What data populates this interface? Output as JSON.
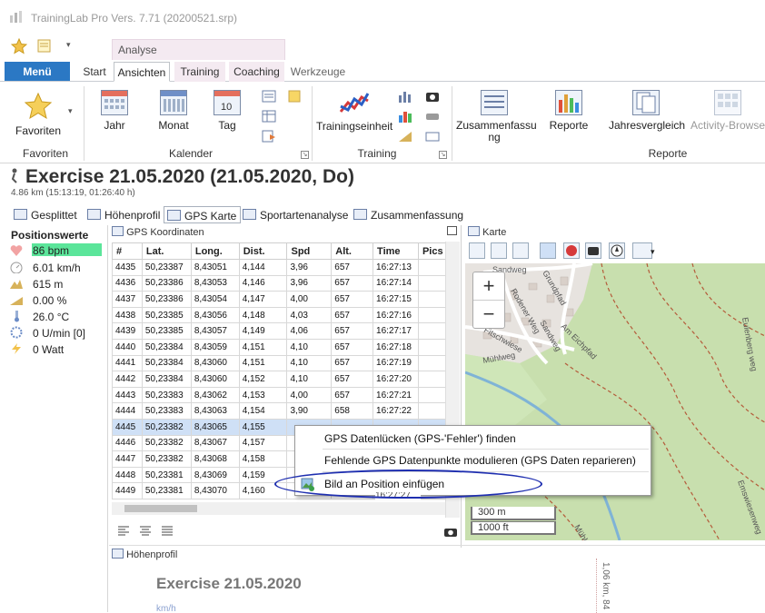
{
  "window": {
    "title": "TrainingLab Pro Vers. 7.71 (20200521.srp)"
  },
  "ribbon_tabs": {
    "menu": "Menü",
    "context_group": "Analyse",
    "items": [
      "Start",
      "Ansichten",
      "Training",
      "Coaching",
      "Werkzeuge"
    ],
    "active": "Ansichten"
  },
  "ribbon": {
    "favoriten": {
      "button": "Favoriten",
      "group": "Favoriten"
    },
    "kalender": {
      "jahr": "Jahr",
      "monat": "Monat",
      "tag": "Tag",
      "tag_icon_number": "10",
      "group": "Kalender"
    },
    "training": {
      "button": "Trainingseinheit",
      "group": "Training"
    },
    "reporte": {
      "zusammenfassung": "Zusammenfassu ng",
      "reporte": "Reporte",
      "jahresvergleich": "Jahresvergleich",
      "activity": "Activity-Browse",
      "group": "Reporte"
    }
  },
  "exercise": {
    "title": "Exercise 21.05.2020 (21.05.2020, Do)",
    "subtitle": "4.86 km (15:13:19, 01:26:40 h)"
  },
  "view_tabs": [
    "Gesplittet",
    "Höhenprofil",
    "GPS Karte",
    "Sportartenanalyse",
    "Zusammenfassung"
  ],
  "positionswerte": {
    "title": "Positionswerte",
    "rows": [
      {
        "icon": "heart-icon",
        "value": "86 bpm"
      },
      {
        "icon": "speedometer-icon",
        "value": "6.01 km/h"
      },
      {
        "icon": "altitude-icon",
        "value": "615 m"
      },
      {
        "icon": "slope-icon",
        "value": "0.00 %"
      },
      {
        "icon": "thermometer-icon",
        "value": "26.0 °C"
      },
      {
        "icon": "cadence-icon",
        "value": "0 U/min [0]"
      },
      {
        "icon": "power-icon",
        "value": "0 Watt"
      }
    ]
  },
  "gps": {
    "title": "GPS Koordinaten",
    "columns": [
      "#",
      "Lat.",
      "Long.",
      "Dist.",
      "Spd",
      "Alt.",
      "Time",
      "Pics"
    ],
    "rows": [
      [
        "4435",
        "50,23387",
        "8,43051",
        "4,144",
        "3,96",
        "657",
        "16:27:13",
        ""
      ],
      [
        "4436",
        "50,23386",
        "8,43053",
        "4,146",
        "3,96",
        "657",
        "16:27:14",
        ""
      ],
      [
        "4437",
        "50,23386",
        "8,43054",
        "4,147",
        "4,00",
        "657",
        "16:27:15",
        ""
      ],
      [
        "4438",
        "50,23385",
        "8,43056",
        "4,148",
        "4,03",
        "657",
        "16:27:16",
        ""
      ],
      [
        "4439",
        "50,23385",
        "8,43057",
        "4,149",
        "4,06",
        "657",
        "16:27:17",
        ""
      ],
      [
        "4440",
        "50,23384",
        "8,43059",
        "4,151",
        "4,10",
        "657",
        "16:27:18",
        ""
      ],
      [
        "4441",
        "50,23384",
        "8,43060",
        "4,151",
        "4,10",
        "657",
        "16:27:19",
        ""
      ],
      [
        "4442",
        "50,23384",
        "8,43060",
        "4,152",
        "4,10",
        "657",
        "16:27:20",
        ""
      ],
      [
        "4443",
        "50,23383",
        "8,43062",
        "4,153",
        "4,00",
        "657",
        "16:27:21",
        ""
      ],
      [
        "4444",
        "50,23383",
        "8,43063",
        "4,154",
        "3,90",
        "658",
        "16:27:22",
        ""
      ],
      [
        "4445",
        "50,23382",
        "8,43065",
        "4,155",
        "",
        "",
        "",
        ""
      ],
      [
        "4446",
        "50,23382",
        "8,43067",
        "4,157",
        "",
        "",
        "",
        ""
      ],
      [
        "4447",
        "50,23382",
        "8,43068",
        "4,158",
        "",
        "",
        "",
        ""
      ],
      [
        "4448",
        "50,23381",
        "8,43069",
        "4,159",
        "",
        "",
        "",
        ""
      ],
      [
        "4449",
        "50,23381",
        "8,43070",
        "4,160",
        "",
        "",
        "",
        ""
      ]
    ],
    "selected_row": "4445"
  },
  "map": {
    "title": "Karte",
    "zoom_in": "+",
    "zoom_out": "−",
    "scale_metric": "300 m",
    "scale_imperial": "1000 ft",
    "streets": [
      "Sandweg",
      "Rodener Weg",
      "Sandweg",
      "Am Eichpfad",
      "Fitschwiese",
      "Mühlweg",
      "Mühlweg",
      "Grundpfad",
      "Eulenberg weg",
      "Emswiesenweg"
    ]
  },
  "context_menu": {
    "items": [
      "GPS Datenlücken (GPS-'Fehler') finden",
      "Fehlende GPS Datenpunkte modulieren (GPS Daten reparieren)",
      "Bild an Position einfügen"
    ],
    "partial_time": "16:27:27"
  },
  "hoehenprofil": {
    "title": "Höhenprofil",
    "chart_title": "Exercise 21.05.2020",
    "axis_unit": "km/h",
    "side_text": "1,06 km, 84"
  },
  "colors": {
    "menu_blue": "#2b78c4",
    "heart_rate": "#5be59a",
    "selection": "#cfe0f6",
    "ellipse": "#1f2fb0"
  }
}
